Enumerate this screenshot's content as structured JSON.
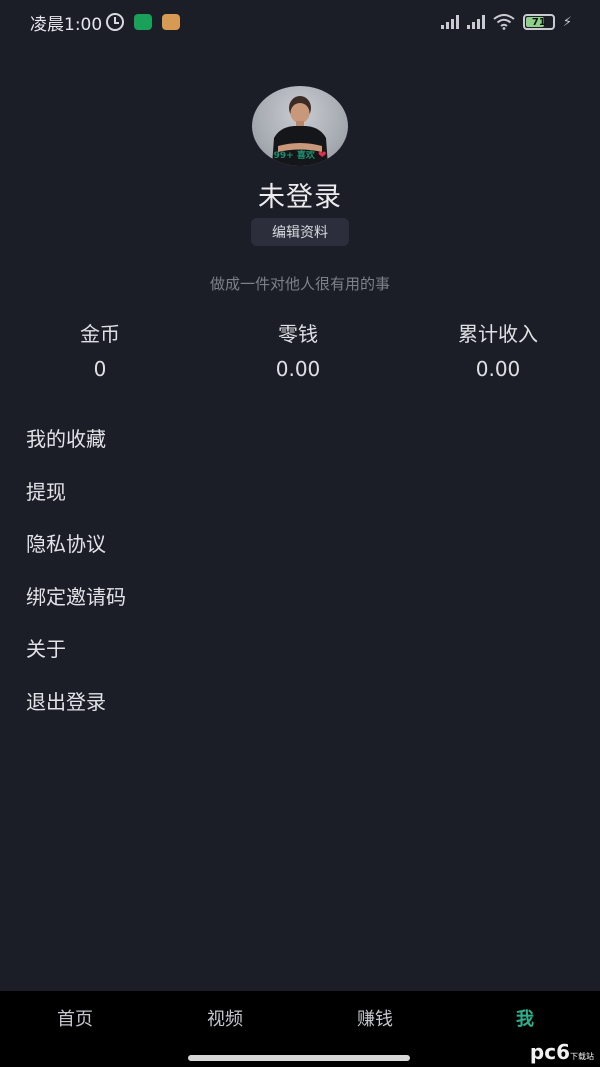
{
  "status_bar": {
    "time": "凌晨1:00",
    "battery_level": 71,
    "battery_text": "71"
  },
  "profile": {
    "avatar_likes": "99+ 喜欢",
    "username": "未登录",
    "edit_label": "编辑资料",
    "slogan": "做成一件对他人很有用的事"
  },
  "stats": [
    {
      "label": "金币",
      "value": "0"
    },
    {
      "label": "零钱",
      "value": "0.00"
    },
    {
      "label": "累计收入",
      "value": "0.00"
    }
  ],
  "menu": [
    {
      "label": "我的收藏"
    },
    {
      "label": "提现"
    },
    {
      "label": "隐私协议"
    },
    {
      "label": "绑定邀请码"
    },
    {
      "label": "关于"
    },
    {
      "label": "退出登录"
    }
  ],
  "nav": [
    {
      "label": "首页"
    },
    {
      "label": "视频"
    },
    {
      "label": "赚钱"
    },
    {
      "label": "我"
    }
  ],
  "watermark": {
    "main": "pc6",
    "sub": "下载站"
  },
  "colors": {
    "accent": "#2fae8c",
    "background": "#1b1d27",
    "nav_background": "#000000"
  }
}
